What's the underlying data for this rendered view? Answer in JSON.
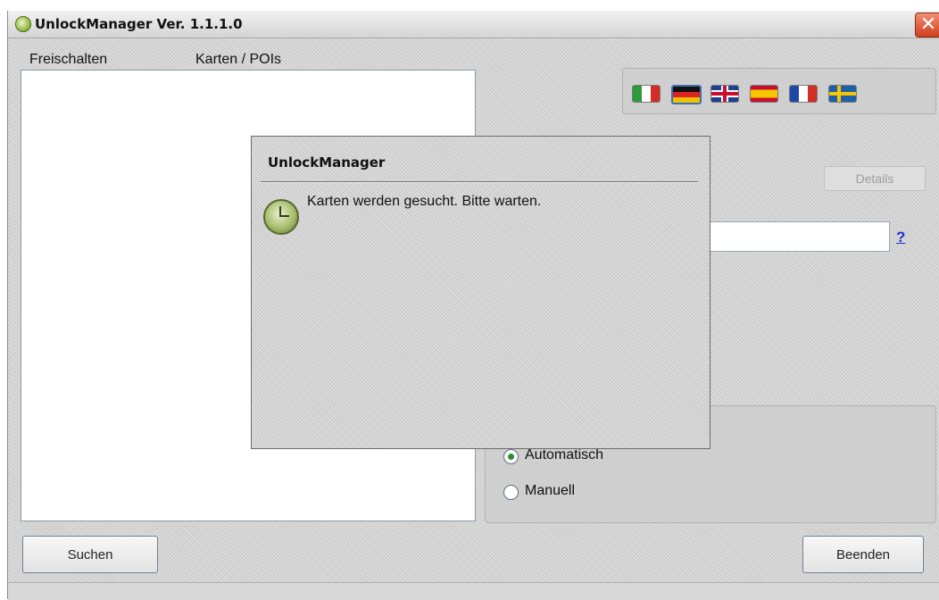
{
  "window": {
    "title": "UnlockManager Ver. 1.1.1.0",
    "close_glyph": "✕"
  },
  "tabs": [
    {
      "label": "Freischalten"
    },
    {
      "label": "Karten / POIs"
    }
  ],
  "languages": [
    {
      "icon": "flag-italy-icon"
    },
    {
      "icon": "flag-germany-icon",
      "selected": true
    },
    {
      "icon": "flag-uk-icon"
    },
    {
      "icon": "flag-spain-icon"
    },
    {
      "icon": "flag-france-icon"
    },
    {
      "icon": "flag-sweden-icon"
    }
  ],
  "details_button": {
    "label": "Details"
  },
  "code_field": {
    "value": ""
  },
  "help_link": {
    "label": "?"
  },
  "mode_group": {
    "options": [
      {
        "label": "Automatisch",
        "selected": true
      },
      {
        "label": "Manuell",
        "selected": false
      }
    ]
  },
  "buttons": {
    "search_label": "Suchen",
    "exit_label": "Beenden"
  },
  "dialog": {
    "title": "UnlockManager",
    "message": "Karten werden gesucht. Bitte warten.",
    "icon": "clock-icon"
  },
  "colors": {
    "link": "#1c33c8",
    "close": "#d0401d"
  }
}
